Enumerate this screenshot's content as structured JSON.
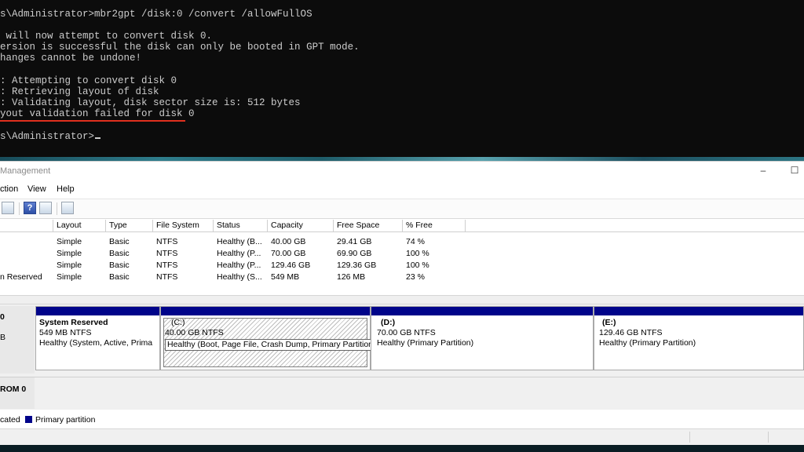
{
  "console": {
    "lines": [
      "s\\Administrator>mbr2gpt /disk:0 /convert /allowFullOS",
      "",
      " will now attempt to convert disk 0.",
      "ersion is successful the disk can only be booted in GPT mode.",
      "hanges cannot be undone!",
      "",
      ": Attempting to convert disk 0",
      ": Retrieving layout of disk",
      ": Validating layout, disk sector size is: 512 bytes",
      "yout validation failed for disk 0",
      "",
      "s\\Administrator>"
    ]
  },
  "window": {
    "title": "Management",
    "minimize": "–",
    "maximize": "☐"
  },
  "menu": {
    "items": [
      "ction",
      "View",
      "Help"
    ]
  },
  "volume_list": {
    "columns": [
      "Layout",
      "Type",
      "File System",
      "Status",
      "Capacity",
      "Free Space",
      "% Free"
    ],
    "rows": [
      {
        "name": "",
        "layout": "Simple",
        "type": "Basic",
        "fs": "NTFS",
        "status": "Healthy (B...",
        "capacity": "40.00 GB",
        "free": "29.41 GB",
        "pct": "74 %"
      },
      {
        "name": "",
        "layout": "Simple",
        "type": "Basic",
        "fs": "NTFS",
        "status": "Healthy (P...",
        "capacity": "70.00 GB",
        "free": "69.90 GB",
        "pct": "100 %"
      },
      {
        "name": "",
        "layout": "Simple",
        "type": "Basic",
        "fs": "NTFS",
        "status": "Healthy (P...",
        "capacity": "129.46 GB",
        "free": "129.36 GB",
        "pct": "100 %"
      },
      {
        "name": "n Reserved",
        "layout": "Simple",
        "type": "Basic",
        "fs": "NTFS",
        "status": "Healthy (S...",
        "capacity": "549 MB",
        "free": "126 MB",
        "pct": "23 %"
      }
    ]
  },
  "disks": {
    "disk0": {
      "label_line1": "0",
      "label_line2": "B",
      "partitions": [
        {
          "name": "System Reserved",
          "size": "549 MB NTFS",
          "status": "Healthy (System, Active, Prima"
        },
        {
          "name": "(C:)",
          "size": "40.00 GB NTFS",
          "status": "Healthy (Boot, Page File, Crash Dump, Primary Partition)"
        },
        {
          "name": "(D:)",
          "size": "70.00 GB NTFS",
          "status": "Healthy (Primary Partition)"
        },
        {
          "name": "(E:)",
          "size": "129.46 GB NTFS",
          "status": "Healthy (Primary Partition)"
        }
      ]
    },
    "cdrom0": {
      "label": "ROM 0"
    }
  },
  "legend": {
    "unallocated": "cated",
    "primary": "Primary partition",
    "primary_color": "#00048a"
  },
  "colors": {
    "console_bg": "#0c0c0c",
    "console_fg": "#cccccc",
    "error_underline": "#e0301e"
  }
}
